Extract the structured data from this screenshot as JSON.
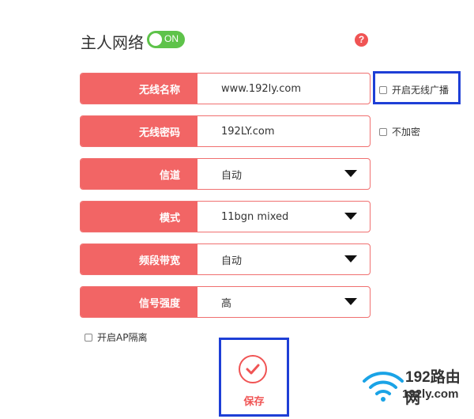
{
  "header": {
    "title": "主人网络",
    "toggle_label": "ON",
    "help_label": "?"
  },
  "form": {
    "rows": [
      {
        "label": "无线名称",
        "value": "www.192ly.com"
      },
      {
        "label": "无线密码",
        "value": "192LY.com"
      },
      {
        "label": "信道",
        "value": "自动"
      },
      {
        "label": "模式",
        "value": "11bgn mixed"
      },
      {
        "label": "频段带宽",
        "value": "自动"
      },
      {
        "label": "信号强度",
        "value": "高"
      }
    ],
    "enable_broadcast_label": "开启无线广播",
    "no_encryption_label": "不加密",
    "ap_isolation_label": "开启AP隔离"
  },
  "actions": {
    "save_label": "保存"
  },
  "watermark": {
    "brand": "192路由网",
    "domain": "192ly.com"
  },
  "colors": {
    "accent": "#f26565",
    "toggle_on": "#5ec34a",
    "highlight": "#1e3fd6"
  }
}
